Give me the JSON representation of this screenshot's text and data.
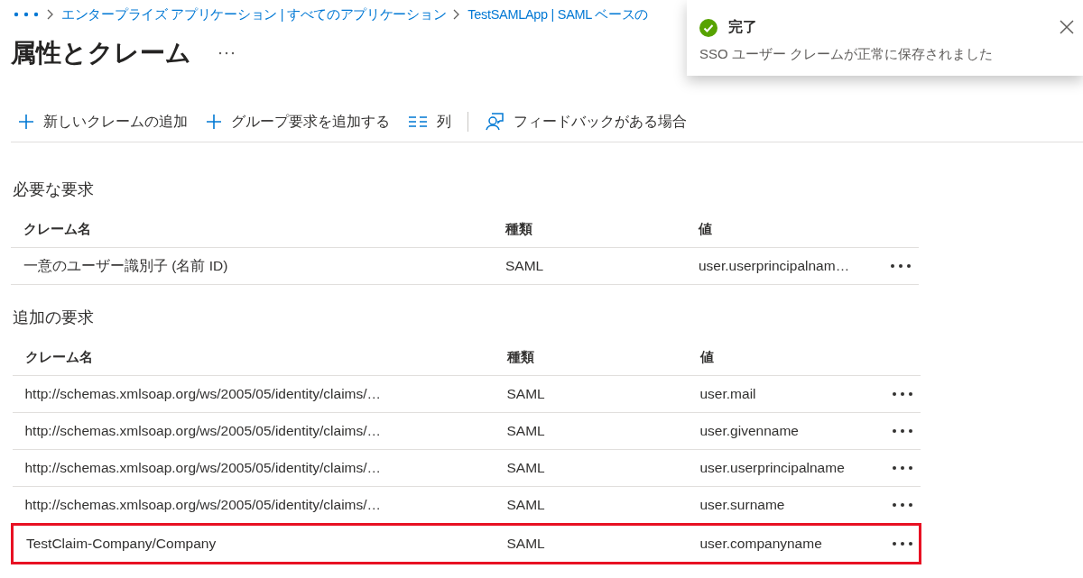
{
  "breadcrumb": {
    "items": [
      "エンタープライズ アプリケーション | すべてのアプリケーション",
      "TestSAMLApp | SAML ベースの"
    ]
  },
  "title": "属性とクレーム",
  "toolbar": [
    {
      "kind": "plus",
      "label": "新しいクレームの追加"
    },
    {
      "kind": "plus",
      "label": "グループ要求を追加する"
    },
    {
      "kind": "columns",
      "label": "列"
    },
    {
      "kind": "feedback",
      "label": "フィードバックがある場合"
    }
  ],
  "sections": [
    {
      "title": "必要な要求",
      "columns": [
        "クレーム名",
        "種類",
        "値"
      ],
      "rows": [
        {
          "name": "一意のユーザー識別子 (名前 ID)",
          "type": "SAML",
          "value": "user.userprincipalnam…",
          "highlighted": false
        }
      ]
    },
    {
      "title": "追加の要求",
      "columns": [
        "クレーム名",
        "種類",
        "値"
      ],
      "rows": [
        {
          "name": "http://schemas.xmlsoap.org/ws/2005/05/identity/claims/…",
          "type": "SAML",
          "value": "user.mail",
          "highlighted": false
        },
        {
          "name": "http://schemas.xmlsoap.org/ws/2005/05/identity/claims/…",
          "type": "SAML",
          "value": "user.givenname",
          "highlighted": false
        },
        {
          "name": "http://schemas.xmlsoap.org/ws/2005/05/identity/claims/…",
          "type": "SAML",
          "value": "user.userprincipalname",
          "highlighted": false
        },
        {
          "name": "http://schemas.xmlsoap.org/ws/2005/05/identity/claims/…",
          "type": "SAML",
          "value": "user.surname",
          "highlighted": false
        },
        {
          "name": "TestClaim-Company/Company",
          "type": "SAML",
          "value": "user.companyname",
          "highlighted": true
        }
      ]
    }
  ],
  "toast": {
    "title": "完了",
    "message": "SSO ユーザー クレームが正常に保存されました"
  }
}
